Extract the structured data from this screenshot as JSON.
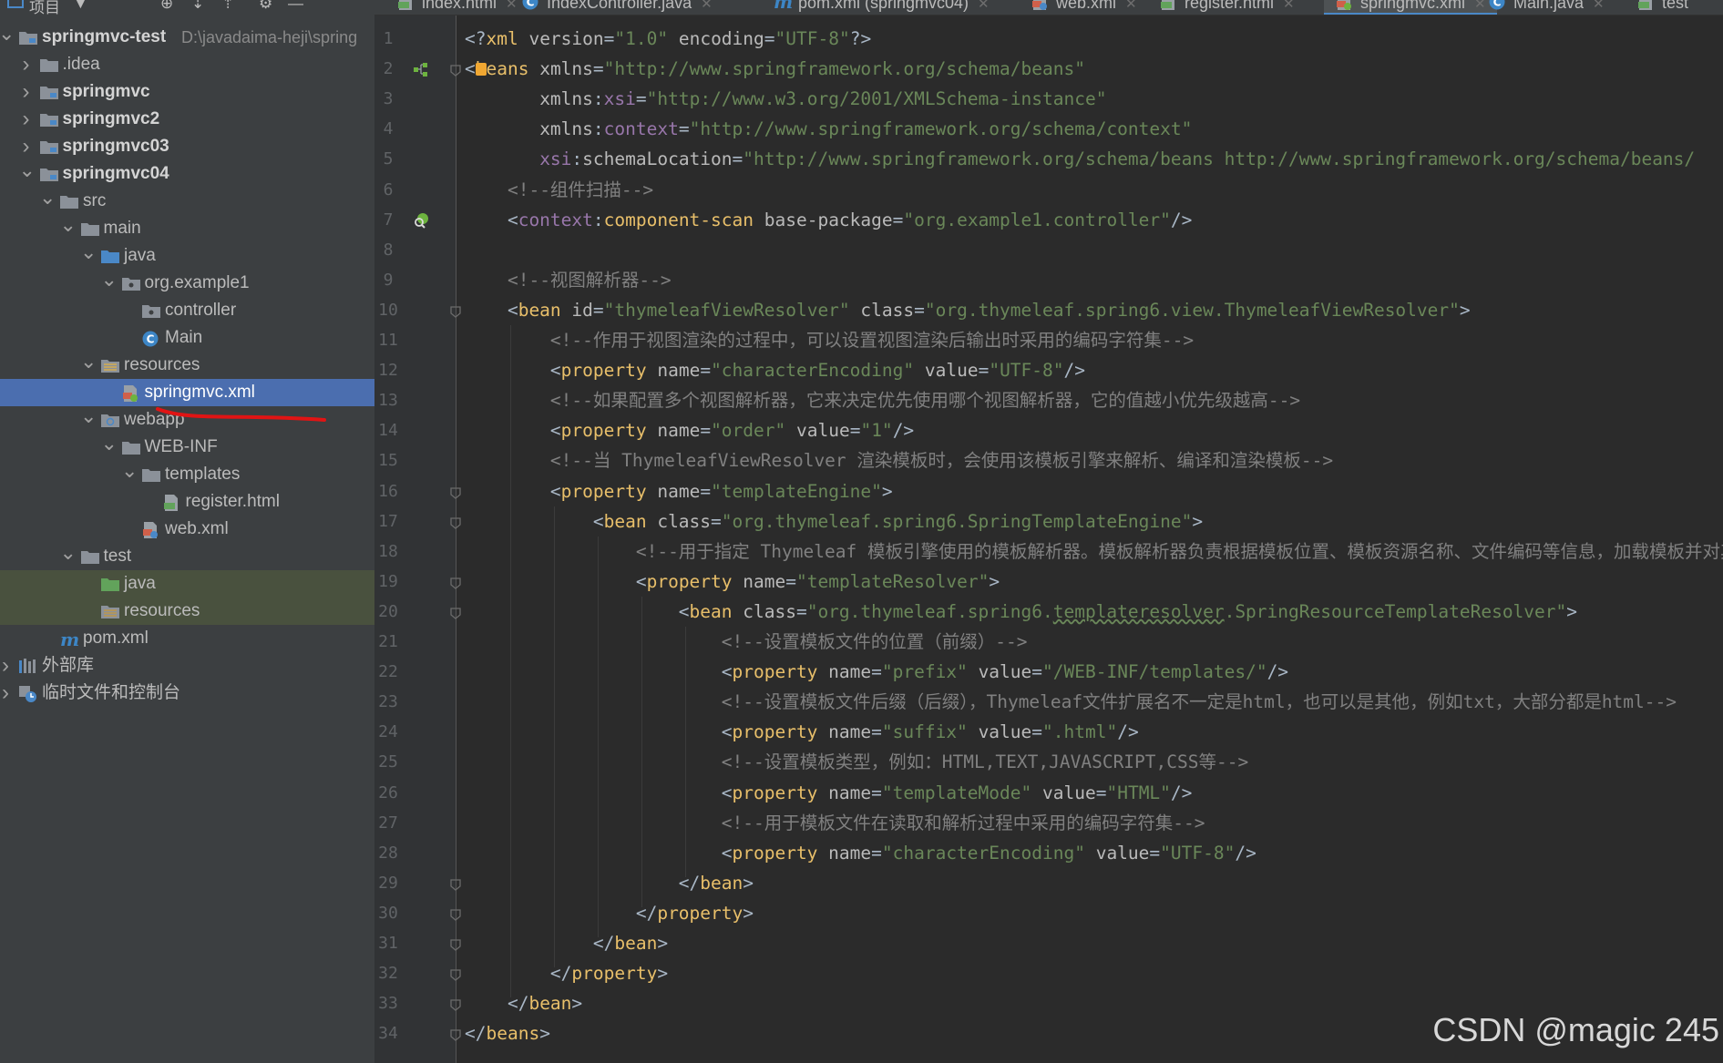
{
  "panel": {
    "title": "项目",
    "tree": [
      {
        "label": "springmvc-test",
        "hint": "D:\\javadaima-heji\\spring",
        "depth": 0,
        "expanded": true,
        "icon": "module-folder-icon",
        "bold": true
      },
      {
        "label": ".idea",
        "depth": 1,
        "expanded": false,
        "icon": "folder-icon"
      },
      {
        "label": "springmvc",
        "depth": 1,
        "expanded": false,
        "icon": "module-folder-icon",
        "bold": true
      },
      {
        "label": "springmvc2",
        "depth": 1,
        "expanded": false,
        "icon": "module-folder-icon",
        "bold": true
      },
      {
        "label": "springmvc03",
        "depth": 1,
        "expanded": false,
        "icon": "module-folder-icon",
        "bold": true
      },
      {
        "label": "springmvc04",
        "depth": 1,
        "expanded": true,
        "icon": "module-folder-icon",
        "bold": true
      },
      {
        "label": "src",
        "depth": 2,
        "expanded": true,
        "icon": "folder-icon"
      },
      {
        "label": "main",
        "depth": 3,
        "expanded": true,
        "icon": "folder-icon"
      },
      {
        "label": "java",
        "depth": 4,
        "expanded": true,
        "icon": "source-folder-icon"
      },
      {
        "label": "org.example1",
        "depth": 5,
        "expanded": true,
        "icon": "package-icon"
      },
      {
        "label": "controller",
        "depth": 6,
        "icon": "package-icon"
      },
      {
        "label": "Main",
        "depth": 6,
        "icon": "java-class-icon"
      },
      {
        "label": "resources",
        "depth": 4,
        "expanded": true,
        "icon": "resources-folder-icon"
      },
      {
        "label": "springmvc.xml",
        "depth": 5,
        "icon": "spring-xml-icon",
        "selected": true
      },
      {
        "label": "webapp",
        "depth": 4,
        "expanded": true,
        "icon": "web-folder-icon"
      },
      {
        "label": "WEB-INF",
        "depth": 5,
        "expanded": true,
        "icon": "folder-icon"
      },
      {
        "label": "templates",
        "depth": 6,
        "expanded": true,
        "icon": "folder-icon"
      },
      {
        "label": "register.html",
        "depth": 7,
        "icon": "html-file-icon"
      },
      {
        "label": "web.xml",
        "depth": 6,
        "icon": "web-xml-icon"
      },
      {
        "label": "test",
        "depth": 3,
        "expanded": true,
        "icon": "folder-icon"
      },
      {
        "label": "java",
        "depth": 4,
        "icon": "test-folder-icon",
        "test": true
      },
      {
        "label": "resources",
        "depth": 4,
        "icon": "test-resources-icon",
        "test": true
      },
      {
        "label": "pom.xml",
        "depth": 2,
        "icon": "maven-icon"
      },
      {
        "label": "外部库",
        "depth": 0,
        "expanded": false,
        "icon": "library-icon"
      },
      {
        "label": "临时文件和控制台",
        "depth": 0,
        "expanded": false,
        "icon": "scratch-icon"
      }
    ]
  },
  "tabs": [
    {
      "label": "index.html",
      "icon": "html-file-icon"
    },
    {
      "label": "IndexController.java",
      "icon": "java-class-icon"
    },
    {
      "label": "pom.xml (springmvc04)",
      "icon": "maven-icon"
    },
    {
      "label": "web.xml",
      "icon": "web-xml-icon"
    },
    {
      "label": "register.html",
      "icon": "html-file-icon"
    },
    {
      "label": "springmvc.xml",
      "icon": "spring-xml-icon",
      "active": true
    },
    {
      "label": "Main.java",
      "icon": "java-class-icon"
    },
    {
      "label": "test",
      "icon": "html-file-icon"
    }
  ],
  "editor": {
    "lines": [
      [
        [
          "pun",
          "<?"
        ],
        [
          "tag",
          "xml "
        ],
        [
          "attr",
          "version"
        ],
        [
          "pun",
          "="
        ],
        [
          "str",
          "\"1.0\""
        ],
        [
          "pun",
          " "
        ],
        [
          "attr",
          "encoding"
        ],
        [
          "pun",
          "="
        ],
        [
          "str",
          "\"UTF-8\""
        ],
        [
          "pun",
          "?>"
        ]
      ],
      [
        [
          "pun",
          "<"
        ],
        [
          "tag",
          "beans "
        ],
        [
          "attr",
          "xmlns"
        ],
        [
          "pun",
          "="
        ],
        [
          "str",
          "\"http://www.springframework.org/schema/beans\""
        ]
      ],
      [
        [
          "pun",
          "       "
        ],
        [
          "attr",
          "xmlns"
        ],
        [
          "pun",
          ":"
        ],
        [
          "ns",
          "xsi"
        ],
        [
          "pun",
          "="
        ],
        [
          "str",
          "\"http://www.w3.org/2001/XMLSchema-instance\""
        ]
      ],
      [
        [
          "pun",
          "       "
        ],
        [
          "attr",
          "xmlns"
        ],
        [
          "pun",
          ":"
        ],
        [
          "ns",
          "context"
        ],
        [
          "pun",
          "="
        ],
        [
          "str",
          "\"http://www.springframework.org/schema/context\""
        ]
      ],
      [
        [
          "pun",
          "       "
        ],
        [
          "ns",
          "xsi"
        ],
        [
          "pun",
          ":"
        ],
        [
          "attr",
          "schemaLocation"
        ],
        [
          "pun",
          "="
        ],
        [
          "str",
          "\"http://www.springframework.org/schema/beans http://www.springframework.org/schema/beans/"
        ]
      ],
      [
        [
          "pun",
          "    "
        ],
        [
          "com",
          "<!--组件扫描-->"
        ]
      ],
      [
        [
          "pun",
          "    <"
        ],
        [
          "ns",
          "context"
        ],
        [
          "pun",
          ":"
        ],
        [
          "tag",
          "component-scan "
        ],
        [
          "attr",
          "base-package"
        ],
        [
          "pun",
          "="
        ],
        [
          "str",
          "\"org.example1.controller\""
        ],
        [
          "pun",
          "/>"
        ]
      ],
      [],
      [
        [
          "pun",
          "    "
        ],
        [
          "com",
          "<!--视图解析器-->"
        ]
      ],
      [
        [
          "pun",
          "    <"
        ],
        [
          "tag",
          "bean "
        ],
        [
          "attr",
          "id"
        ],
        [
          "pun",
          "="
        ],
        [
          "str",
          "\"thymeleafViewResolver\""
        ],
        [
          "pun",
          " "
        ],
        [
          "attr",
          "class"
        ],
        [
          "pun",
          "="
        ],
        [
          "str",
          "\"org.thymeleaf.spring6.view.ThymeleafViewResolver\""
        ],
        [
          "pun",
          ">"
        ]
      ],
      [
        [
          "pun",
          "        "
        ],
        [
          "com",
          "<!--作用于视图渲染的过程中，可以设置视图渲染后输出时采用的编码字符集-->"
        ]
      ],
      [
        [
          "pun",
          "        <"
        ],
        [
          "tag",
          "property "
        ],
        [
          "attr",
          "name"
        ],
        [
          "pun",
          "="
        ],
        [
          "str",
          "\"characterEncoding\""
        ],
        [
          "pun",
          " "
        ],
        [
          "attr",
          "value"
        ],
        [
          "pun",
          "="
        ],
        [
          "str",
          "\"UTF-8\""
        ],
        [
          "pun",
          "/>"
        ]
      ],
      [
        [
          "pun",
          "        "
        ],
        [
          "com",
          "<!--如果配置多个视图解析器，它来决定优先使用哪个视图解析器，它的值越小优先级越高-->"
        ]
      ],
      [
        [
          "pun",
          "        <"
        ],
        [
          "tag",
          "property "
        ],
        [
          "attr",
          "name"
        ],
        [
          "pun",
          "="
        ],
        [
          "str",
          "\"order\""
        ],
        [
          "pun",
          " "
        ],
        [
          "attr",
          "value"
        ],
        [
          "pun",
          "="
        ],
        [
          "str",
          "\"1\""
        ],
        [
          "pun",
          "/>"
        ]
      ],
      [
        [
          "pun",
          "        "
        ],
        [
          "com",
          "<!--当 ThymeleafViewResolver 渲染模板时，会使用该模板引擎来解析、编译和渲染模板-->"
        ]
      ],
      [
        [
          "pun",
          "        <"
        ],
        [
          "tag",
          "property "
        ],
        [
          "attr",
          "name"
        ],
        [
          "pun",
          "="
        ],
        [
          "str",
          "\"templateEngine\""
        ],
        [
          "pun",
          ">"
        ]
      ],
      [
        [
          "pun",
          "            <"
        ],
        [
          "tag",
          "bean "
        ],
        [
          "attr",
          "class"
        ],
        [
          "pun",
          "="
        ],
        [
          "str",
          "\"org.thymeleaf.spring6.SpringTemplateEngine\""
        ],
        [
          "pun",
          ">"
        ]
      ],
      [
        [
          "pun",
          "                "
        ],
        [
          "com",
          "<!--用于指定 Thymeleaf 模板引擎使用的模板解析器。模板解析器负责根据模板位置、模板资源名称、文件编码等信息，加载模板并对其"
        ]
      ],
      [
        [
          "pun",
          "                <"
        ],
        [
          "tag",
          "property "
        ],
        [
          "attr",
          "name"
        ],
        [
          "pun",
          "="
        ],
        [
          "str",
          "\"templateResolver\""
        ],
        [
          "pun",
          ">"
        ]
      ],
      [
        [
          "pun",
          "                    <"
        ],
        [
          "tag",
          "bean "
        ],
        [
          "attr",
          "class"
        ],
        [
          "pun",
          "="
        ],
        [
          "str",
          "\"org.thymeleaf.spring6."
        ],
        [
          "ul",
          "templateresolver"
        ],
        [
          "str",
          ".SpringResourceTemplateResolver\""
        ],
        [
          "pun",
          ">"
        ]
      ],
      [
        [
          "pun",
          "                        "
        ],
        [
          "com",
          "<!--设置模板文件的位置（前缀）-->"
        ]
      ],
      [
        [
          "pun",
          "                        <"
        ],
        [
          "tag",
          "property "
        ],
        [
          "attr",
          "name"
        ],
        [
          "pun",
          "="
        ],
        [
          "str",
          "\"prefix\""
        ],
        [
          "pun",
          " "
        ],
        [
          "attr",
          "value"
        ],
        [
          "pun",
          "="
        ],
        [
          "str",
          "\"/WEB-INF/templates/\""
        ],
        [
          "pun",
          "/>"
        ]
      ],
      [
        [
          "pun",
          "                        "
        ],
        [
          "com",
          "<!--设置模板文件后缀（后缀），Thymeleaf文件扩展名不一定是html，也可以是其他，例如txt，大部分都是html-->"
        ]
      ],
      [
        [
          "pun",
          "                        <"
        ],
        [
          "tag",
          "property "
        ],
        [
          "attr",
          "name"
        ],
        [
          "pun",
          "="
        ],
        [
          "str",
          "\"suffix\""
        ],
        [
          "pun",
          " "
        ],
        [
          "attr",
          "value"
        ],
        [
          "pun",
          "="
        ],
        [
          "str",
          "\".html\""
        ],
        [
          "pun",
          "/>"
        ]
      ],
      [
        [
          "pun",
          "                        "
        ],
        [
          "com",
          "<!--设置模板类型，例如：HTML,TEXT,JAVASCRIPT,CSS等-->"
        ]
      ],
      [
        [
          "pun",
          "                        <"
        ],
        [
          "tag",
          "property "
        ],
        [
          "attr",
          "name"
        ],
        [
          "pun",
          "="
        ],
        [
          "str",
          "\"templateMode\""
        ],
        [
          "pun",
          " "
        ],
        [
          "attr",
          "value"
        ],
        [
          "pun",
          "="
        ],
        [
          "str",
          "\"HTML\""
        ],
        [
          "pun",
          "/>"
        ]
      ],
      [
        [
          "pun",
          "                        "
        ],
        [
          "com",
          "<!--用于模板文件在读取和解析过程中采用的编码字符集-->"
        ]
      ],
      [
        [
          "pun",
          "                        <"
        ],
        [
          "tag",
          "property "
        ],
        [
          "attr",
          "name"
        ],
        [
          "pun",
          "="
        ],
        [
          "str",
          "\"characterEncoding\""
        ],
        [
          "pun",
          " "
        ],
        [
          "attr",
          "value"
        ],
        [
          "pun",
          "="
        ],
        [
          "str",
          "\"UTF-8\""
        ],
        [
          "pun",
          "/>"
        ]
      ],
      [
        [
          "pun",
          "                    </"
        ],
        [
          "tag",
          "bean"
        ],
        [
          "pun",
          ">"
        ]
      ],
      [
        [
          "pun",
          "                </"
        ],
        [
          "tag",
          "property"
        ],
        [
          "pun",
          ">"
        ]
      ],
      [
        [
          "pun",
          "            </"
        ],
        [
          "tag",
          "bean"
        ],
        [
          "pun",
          ">"
        ]
      ],
      [
        [
          "pun",
          "        </"
        ],
        [
          "tag",
          "property"
        ],
        [
          "pun",
          ">"
        ]
      ],
      [
        [
          "pun",
          "    </"
        ],
        [
          "tag",
          "bean"
        ],
        [
          "pun",
          ">"
        ]
      ],
      [
        [
          "pun",
          "</"
        ],
        [
          "tag",
          "beans"
        ],
        [
          "pun",
          ">"
        ]
      ]
    ],
    "folds": [
      2,
      10,
      16,
      17,
      19,
      20,
      29,
      30,
      31,
      32,
      33,
      34
    ],
    "gutter_icons": {
      "2": "spring-bean-gutter-icon",
      "7": "component-scan-gutter-icon"
    }
  },
  "watermark": "CSDN @magic 245"
}
